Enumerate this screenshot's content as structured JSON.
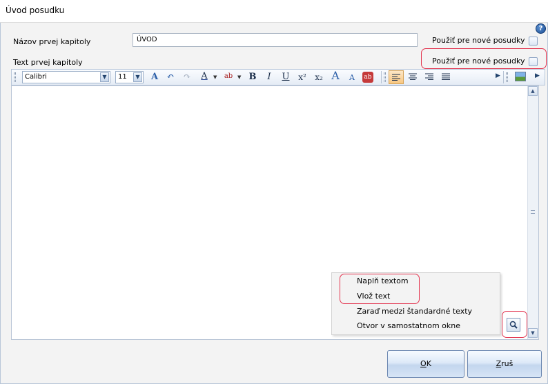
{
  "window": {
    "title": "Úvod posudku",
    "help_label": "?"
  },
  "form": {
    "chapter_name_label": "Názov prvej kapitoly",
    "chapter_name_value": "ÚVOD",
    "chapter_text_label": "Text prvej kapitoly",
    "use_for_new_label_1": "Použiť pre nové posudky",
    "use_for_new_label_2": "Použiť pre nové posudky"
  },
  "toolbar": {
    "font_family": "Calibri",
    "font_size": "11",
    "buttons": {
      "bold": "B",
      "italic": "I",
      "underline": "U",
      "superscript": "x²",
      "subscript": "x₂",
      "grow_font": "A",
      "shrink_font": "A",
      "font_color": "A",
      "clear_format": "ab"
    }
  },
  "context_menu": {
    "items": [
      "Naplň textom",
      "Vlož text",
      "Zaraď medzi štandardné texty",
      "Otvor v samostatnom okne"
    ]
  },
  "buttons": {
    "ok_first": "O",
    "ok_rest": "K",
    "cancel_first": "Z",
    "cancel_rest": "ruš"
  },
  "colors": {
    "highlight": "#e3334e",
    "accent": "#1d4f95"
  }
}
